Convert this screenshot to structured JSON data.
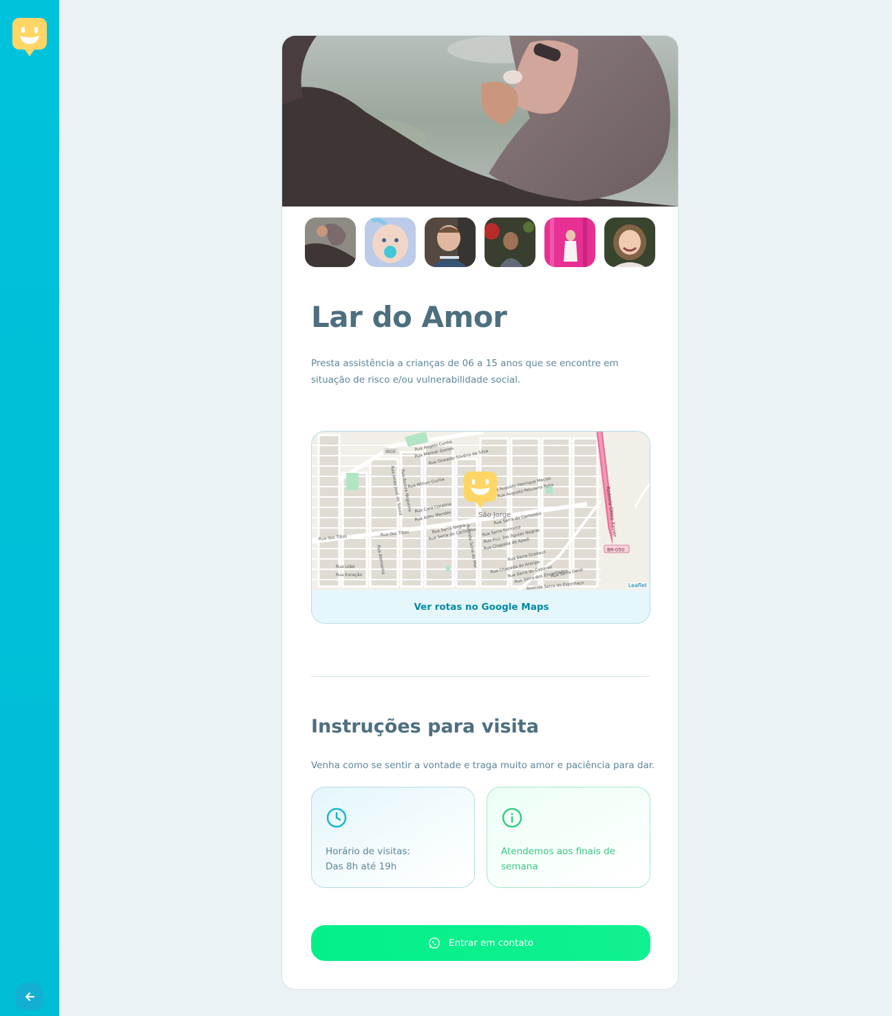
{
  "sidebar": {
    "logo": "happy-face-logo",
    "back_icon": "arrow-left-icon"
  },
  "orphanage": {
    "name": "Lar do Amor",
    "about": "Presta assistência a crianças de 06 a 15 anos que se encontre em situação de risco e/ou vulnerabilidade social.",
    "images": [
      {
        "label": "photo-1",
        "active": true
      },
      {
        "label": "photo-2",
        "active": false
      },
      {
        "label": "photo-3",
        "active": false
      },
      {
        "label": "photo-4",
        "active": false
      },
      {
        "label": "photo-5",
        "active": false
      },
      {
        "label": "photo-6",
        "active": false
      }
    ]
  },
  "map": {
    "link_label": "Ver rotas no Google Maps",
    "attribution": "Leaflet",
    "neighborhood": "São Jorge",
    "highway_label": "Rodovia Chico Xavier",
    "road_badge": "BR-050",
    "streets": [
      "Rua Angelo Cunha",
      "Rua Manoel Gomes",
      "Rua Oswaldo Silvério da Silva",
      "Rua Wilson Cunha",
      "Rua Cora Coralina",
      "Rua Adeu Mendes",
      "Rua dos Tibos",
      "Rua Serra Negra",
      "Rua Serra do Cachimbo",
      "Rua Serra Formosa",
      "Rua Pico das Águias Negras",
      "Rua Chapada do Apodi",
      "Rua Serra Gradaus",
      "Rua Chapada do Araripe",
      "Rua Serra do Caparaó",
      "Rua Serra dos Encantados",
      "Rua Serra Geral",
      "Avenida Serra do Espinhaço",
      "Rua Augusto Peluzena Rosa",
      "Rua Augusto Henrique Macias",
      "IBGE",
      "Avenida Serra do Mar",
      "Rua Líder",
      "Rua Exceção",
      "Rua Alemanha"
    ]
  },
  "visit": {
    "title": "Instruções para visita",
    "instructions": "Venha como se sentir a vontade e traga muito amor e paciência para dar.",
    "hours_icon": "clock-icon",
    "hours_text": "Horário de visitas:\nDas 8h até 19h",
    "weekend_icon": "info-icon",
    "weekend_text": "Atendemos aos finais de\nsemana"
  },
  "contact": {
    "label": "Entrar em contato",
    "icon": "whatsapp-icon"
  },
  "colors": {
    "sidebar": "#00c0d8",
    "accent_green": "#09f08c",
    "title": "#4d6f80",
    "text": "#5c8599",
    "link": "#0089a5"
  }
}
